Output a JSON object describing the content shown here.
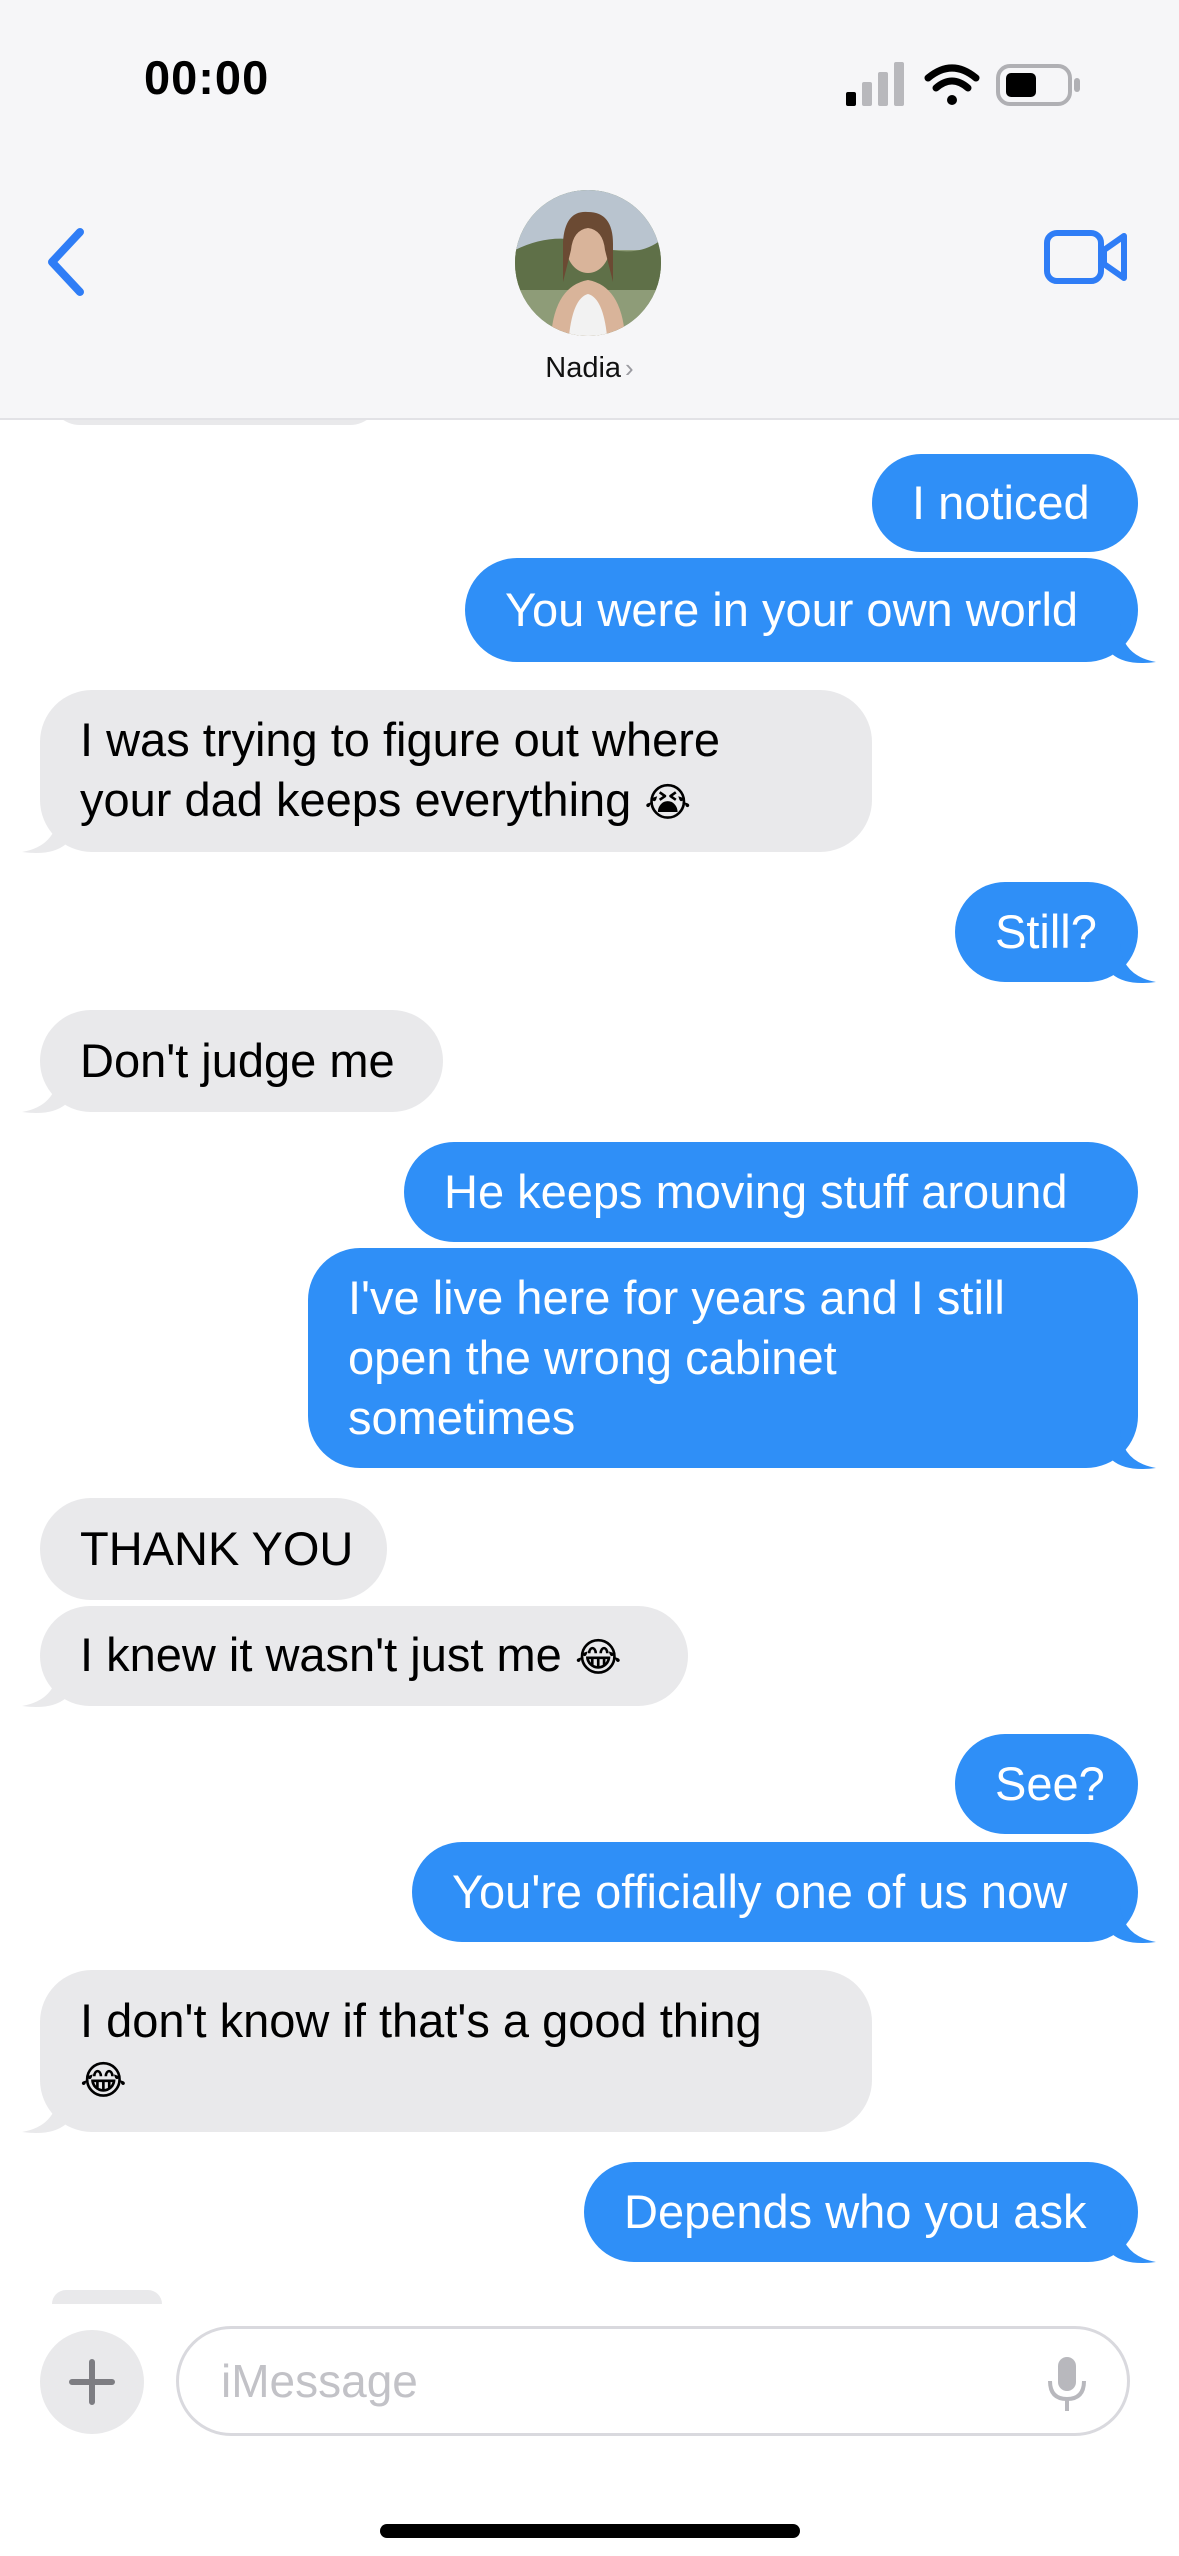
{
  "status_bar": {
    "time": "00:00"
  },
  "header": {
    "contact_name": "Nadia",
    "chevron": "›"
  },
  "messages": [
    {
      "from": "me",
      "text": "I noticed"
    },
    {
      "from": "me",
      "text": "You were in your own world"
    },
    {
      "from": "them",
      "line1": "I was trying to figure out where",
      "line2": "your dad keeps everything",
      "emoji": "😭"
    },
    {
      "from": "me",
      "text": "Still?"
    },
    {
      "from": "them",
      "text": "Don't judge me"
    },
    {
      "from": "me",
      "text": "He keeps moving stuff around"
    },
    {
      "from": "me",
      "line1": "I've live here for years and I still",
      "line2": "open the wrong cabinet",
      "line3": "sometimes"
    },
    {
      "from": "them",
      "text": "THANK YOU"
    },
    {
      "from": "them",
      "text": "I knew it wasn't just me",
      "emoji": "😂"
    },
    {
      "from": "me",
      "text": "See?"
    },
    {
      "from": "me",
      "text": "You're officially one of us now"
    },
    {
      "from": "them",
      "line1": "I don't know if that's a good thing",
      "emoji": "😂"
    },
    {
      "from": "me",
      "text": "Depends who you ask"
    }
  ],
  "composer": {
    "placeholder": "iMessage"
  },
  "icons": {
    "back": "back-chevron-icon",
    "video": "video-camera-icon",
    "plus": "plus-icon",
    "mic": "microphone-icon",
    "signal": "cellular-signal-icon",
    "wifi": "wifi-icon",
    "battery": "battery-icon"
  },
  "colors": {
    "sent_bubble": "#2f8ff7",
    "received_bubble": "#e9e9eb",
    "accent": "#2f7df6"
  }
}
